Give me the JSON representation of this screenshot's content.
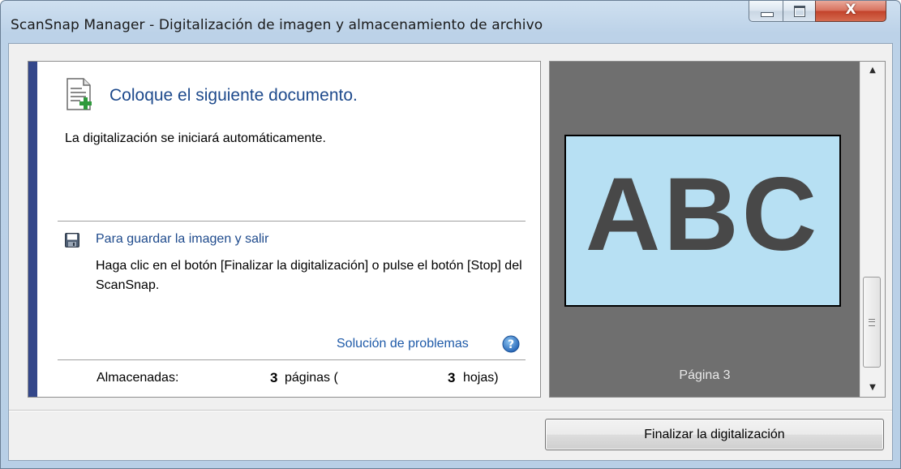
{
  "window": {
    "title": "ScanSnap Manager - Digitalización de imagen y almacenamiento de archivo",
    "close_glyph": "X"
  },
  "status": {
    "heading": "Coloque el siguiente documento.",
    "subtext": "La digitalización se iniciará automáticamente."
  },
  "save_hint": {
    "title": "Para guardar la imagen y salir",
    "text": "Haga clic en el botón [Finalizar la digitalización] o pulse el botón [Stop] del ScanSnap."
  },
  "troubleshooting_link": "Solución de problemas",
  "stats": {
    "label": "Almacenadas:",
    "pages_count": "3",
    "pages_label": "páginas (",
    "sheets_count": "3",
    "sheets_label": "hojas)"
  },
  "preview": {
    "thumbnail_text": "ABC",
    "page_label": "Página 3"
  },
  "finish_button": "Finalizar la digitalización",
  "colors": {
    "accent": "#34478a",
    "heading_blue": "#1e4a8c",
    "preview_bg": "#6f6f6f",
    "thumbnail_bg": "#b7e0f3"
  },
  "icons": [
    "new-document-icon",
    "save-icon",
    "help-icon",
    "scroll-up-icon",
    "scroll-down-icon"
  ]
}
